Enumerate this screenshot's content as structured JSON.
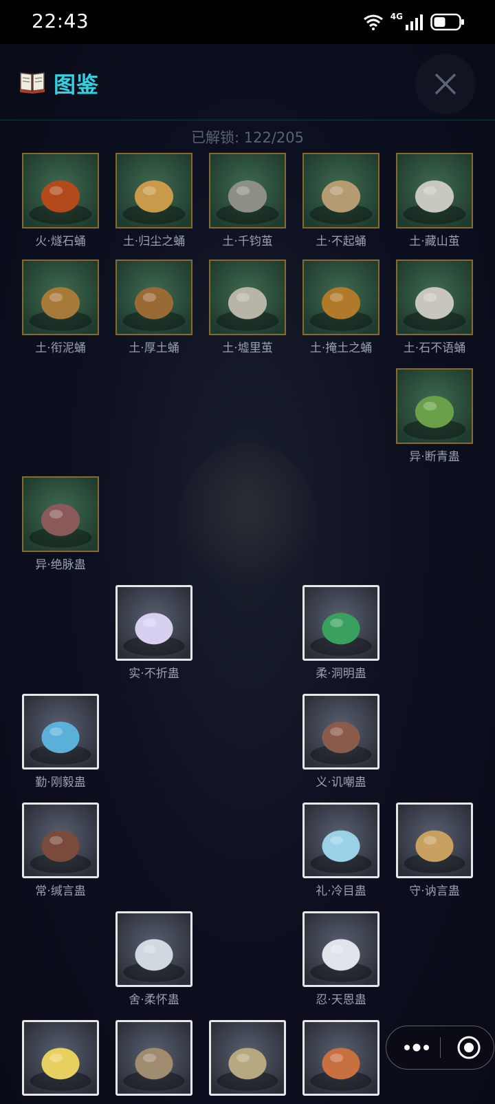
{
  "status_bar": {
    "time": "22:43",
    "network": "4G"
  },
  "header": {
    "title": "图鉴",
    "book_icon": "book-icon",
    "close_icon": "close-icon"
  },
  "progress": {
    "text": "已解锁: 122/205"
  },
  "items": [
    {
      "label": "火·燧石蛹",
      "frame": "gold",
      "theme": "#b24a1c"
    },
    {
      "label": "土·归尘之蛹",
      "frame": "gold",
      "theme": "#c99a4a"
    },
    {
      "label": "土·千钧茧",
      "frame": "gold",
      "theme": "#8d8f86"
    },
    {
      "label": "土·不起蛹",
      "frame": "gold",
      "theme": "#b59b72"
    },
    {
      "label": "土·藏山茧",
      "frame": "gold",
      "theme": "#c8c8c0"
    },
    {
      "label": "土·衔泥蛹",
      "frame": "gold",
      "theme": "#a87a3a"
    },
    {
      "label": "土·厚土蛹",
      "frame": "gold",
      "theme": "#9a6a36"
    },
    {
      "label": "土·墟里茧",
      "frame": "gold",
      "theme": "#b8b4a8"
    },
    {
      "label": "土·掩土之蛹",
      "frame": "gold",
      "theme": "#b07a2a"
    },
    {
      "label": "土·石不语蛹",
      "frame": "gold",
      "theme": "#c8c6bc"
    },
    {
      "label": "异·断青蛊",
      "frame": "gold",
      "theme": "#6aa04a"
    },
    {
      "label": "异·绝脉蛊",
      "frame": "gold",
      "theme": "#8a5a5a"
    },
    {
      "label": "实·不折蛊",
      "frame": "white",
      "theme": "#d8d0f0"
    },
    {
      "label": "柔·洞明蛊",
      "frame": "white",
      "theme": "#3aa060"
    },
    {
      "label": "勤·刚毅蛊",
      "frame": "white",
      "theme": "#5ab0d8"
    },
    {
      "label": "义·讥嘲蛊",
      "frame": "white",
      "theme": "#8a5a4a"
    },
    {
      "label": "常·缄言蛊",
      "frame": "white",
      "theme": "#7a4a3a"
    },
    {
      "label": "礼·冷目蛊",
      "frame": "white",
      "theme": "#9ad0e8"
    },
    {
      "label": "守·讷言蛊",
      "frame": "white",
      "theme": "#c8a060"
    },
    {
      "label": "舍·柔怀蛊",
      "frame": "white",
      "theme": "#d0d8e0"
    },
    {
      "label": "忍·天恩蛊",
      "frame": "white",
      "theme": "#e0e4ea"
    },
    {
      "label": "",
      "frame": "white",
      "theme": "#e8d060"
    },
    {
      "label": "",
      "frame": "white",
      "theme": "#a08a70"
    },
    {
      "label": "",
      "frame": "white",
      "theme": "#b8a880"
    },
    {
      "label": "",
      "frame": "white",
      "theme": "#c87040"
    }
  ],
  "capsule": {
    "more_icon": "more-dots-icon",
    "close_icon": "target-close-icon"
  }
}
